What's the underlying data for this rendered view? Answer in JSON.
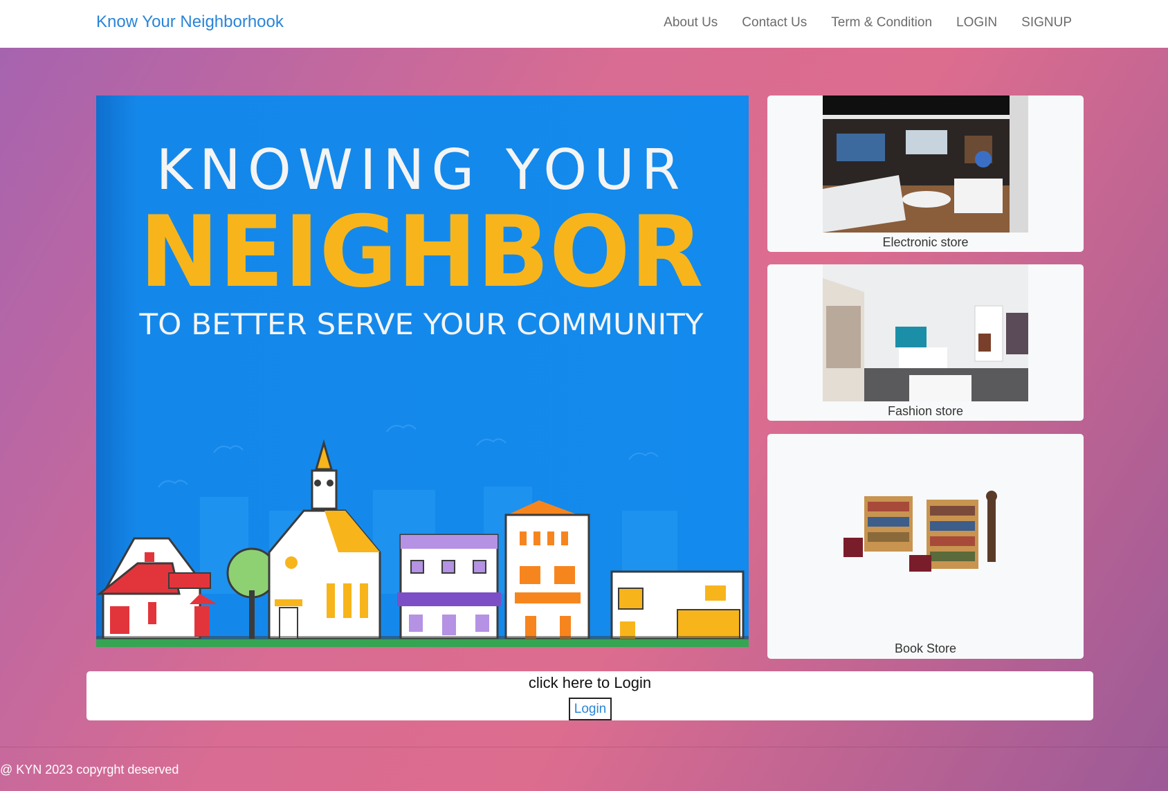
{
  "navbar": {
    "brand": "Know Your Neighborhook",
    "links": [
      "About Us",
      "Contact Us",
      "Term & Condition",
      "LOGIN",
      "SIGNUP"
    ]
  },
  "hero": {
    "line1": "KNOWING YOUR",
    "line2": "NEIGHBOR",
    "line3": "TO BETTER SERVE YOUR COMMUNITY"
  },
  "stores": [
    {
      "caption": "Electronic store"
    },
    {
      "caption": "Fashion store"
    },
    {
      "caption": "Book Store"
    }
  ],
  "login_section": {
    "prompt": "click here to Login",
    "button_label": "Login"
  },
  "footer": {
    "text": "@ KYN 2023 copyrght deserved"
  },
  "colors": {
    "brand": "#2a85d8",
    "hero_blue": "#138aed",
    "hero_yellow": "#f7b51b"
  }
}
